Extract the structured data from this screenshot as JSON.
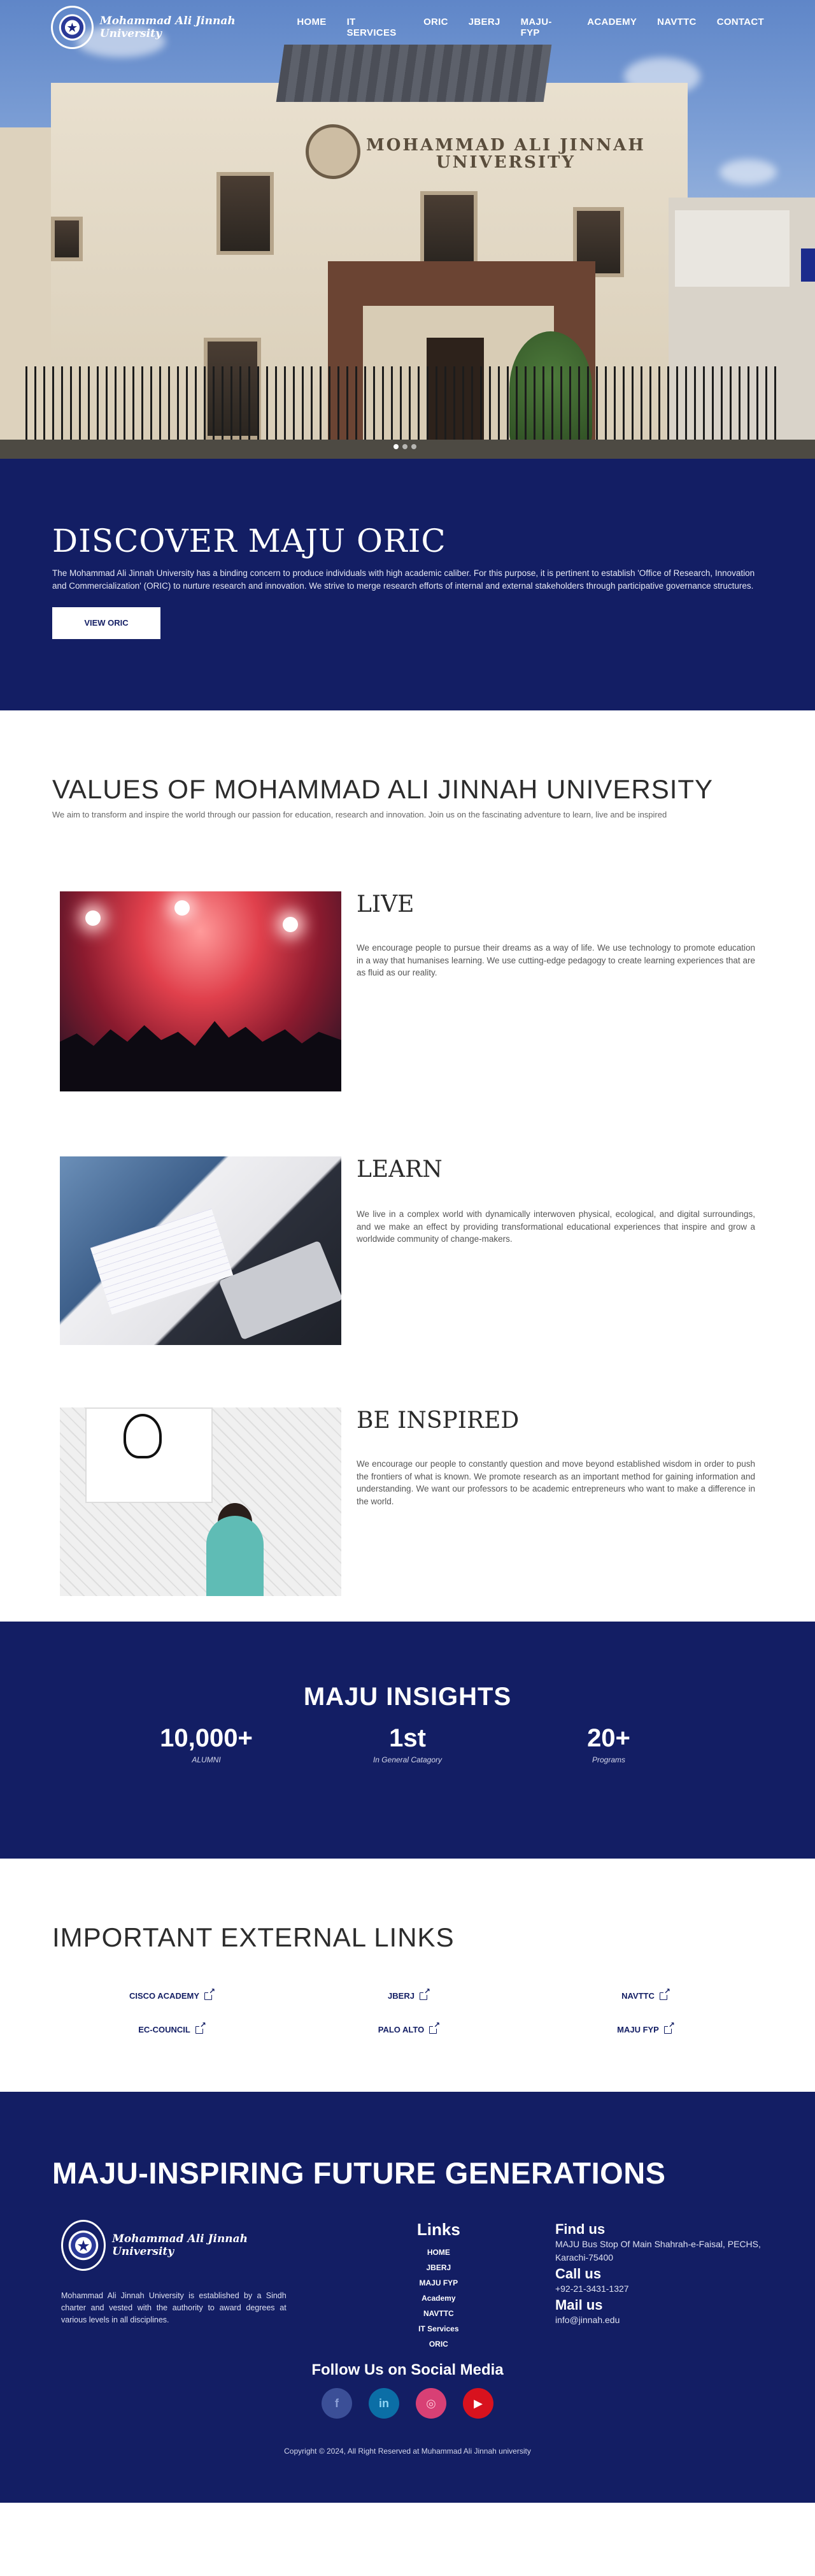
{
  "nav": {
    "logo_text": "Mohammad Ali Jinnah University",
    "items": [
      "HOME",
      "IT SERVICES",
      "ORIC",
      "JBERJ",
      "MAJU-FYP",
      "ACADEMY",
      "NAVTTC",
      "CONTACT"
    ]
  },
  "hero": {
    "sign_line1": "MOHAMMAD ALI JINNAH",
    "sign_line2": "UNIVERSITY",
    "slides": 3,
    "active_slide": 1
  },
  "discover": {
    "title": "DISCOVER MAJU ORIC",
    "text": "The Mohammad Ali Jinnah University has a binding concern to produce individuals with high academic caliber. For this purpose, it is pertinent to establish 'Office of Research, Innovation and Commercialization' (ORIC) to nurture research and innovation. We strive to merge research efforts of internal and external stakeholders through participative governance structures.",
    "button": "VIEW ORIC"
  },
  "values": {
    "title": "VALUES OF MOHAMMAD ALI JINNAH UNIVERSITY",
    "subtitle": "We aim to transform and inspire the world through our passion for education, research and innovation. Join us on the fascinating adventure to learn, live and be inspired",
    "items": [
      {
        "heading": "LIVE",
        "text": "We encourage people to pursue their dreams as a way of life. We use technology to promote education in a way that humanises learning. We use cutting-edge pedagogy to create learning experiences that are as fluid as our reality."
      },
      {
        "heading": "LEARN",
        "text": "We live in a complex world with dynamically interwoven physical, ecological, and digital surroundings, and we make an effect by providing transformational educational experiences that inspire and grow a worldwide community of change-makers."
      },
      {
        "heading": "BE INSPIRED",
        "text": "We encourage our people to constantly question and move beyond established wisdom in order to push the frontiers of what is known. We promote research as an important method for gaining information and understanding. We want our professors to be academic entrepreneurs who want to make a difference in the world."
      }
    ]
  },
  "insights": {
    "title": "MAJU INSIGHTS",
    "stats": [
      {
        "value": "10,000+",
        "label": "ALUMNI"
      },
      {
        "value": "1st",
        "label": "In General Catagory"
      },
      {
        "value": "20+",
        "label": "Programs"
      }
    ]
  },
  "external_links": {
    "title": "IMPORTANT EXTERNAL LINKS",
    "links": [
      "CISCO ACADEMY",
      "JBERJ",
      "NAVTTC",
      "EC-COUNCIL",
      "PALO ALTO",
      "MAJU FYP"
    ]
  },
  "footer": {
    "title": "MAJU-INSPIRING FUTURE GENERATIONS",
    "logo_text": "Mohammad Ali Jinnah University",
    "about": "Mohammad Ali Jinnah University is established by a Sindh charter and vested with the authority to award degrees at various levels in all disciplines.",
    "links_title": "Links",
    "links": [
      "HOME",
      "JBERJ",
      "MAJU FYP",
      "Academy",
      "NAVTTC",
      "IT Services",
      "ORIC"
    ],
    "find_us_title": "Find us",
    "find_us": "MAJU Bus Stop Of Main Shahrah-e-Faisal, PECHS, Karachi-75400",
    "call_title": "Call us",
    "call": "+92-21-3431-1327",
    "mail_title": "Mail us",
    "mail": "info@jinnah.edu",
    "social_title": "Follow Us on Social Media",
    "social_glyphs": [
      "f",
      "in",
      "◎",
      "▶"
    ],
    "copyright": "Copyright © 2024, All Right Reserved at Muhammad Ali Jinnah university"
  }
}
